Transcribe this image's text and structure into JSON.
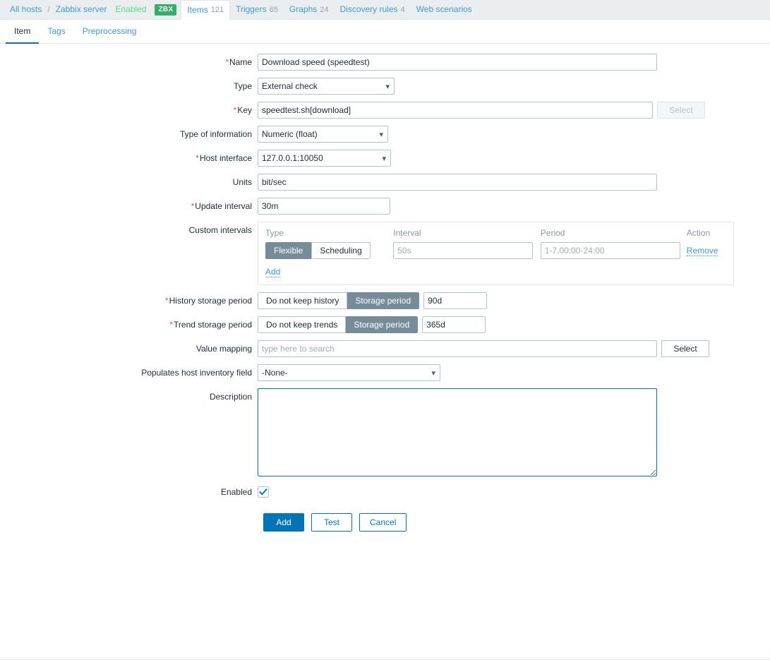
{
  "breadcrumb": {
    "all_hosts": "All hosts",
    "separator": "/",
    "host": "Zabbix server",
    "status": "Enabled",
    "agent_badge": "ZBX",
    "items": [
      {
        "label": "Items",
        "count": "121",
        "selected": true
      },
      {
        "label": "Triggers",
        "count": "65",
        "selected": false
      },
      {
        "label": "Graphs",
        "count": "24",
        "selected": false
      },
      {
        "label": "Discovery rules",
        "count": "4",
        "selected": false
      },
      {
        "label": "Web scenarios",
        "count": "",
        "selected": false
      }
    ]
  },
  "tabs": [
    {
      "label": "Item",
      "active": true
    },
    {
      "label": "Tags",
      "active": false
    },
    {
      "label": "Preprocessing",
      "active": false
    }
  ],
  "form": {
    "name": {
      "label": "Name",
      "required": true,
      "value": "Download speed (speedtest)"
    },
    "type": {
      "label": "Type",
      "required": false,
      "value": "External check"
    },
    "key": {
      "label": "Key",
      "required": true,
      "value": "speedtest.sh[download]",
      "select_button": "Select",
      "select_disabled": true
    },
    "type_of_information": {
      "label": "Type of information",
      "required": false,
      "value": "Numeric (float)"
    },
    "host_interface": {
      "label": "Host interface",
      "required": true,
      "value": "127.0.0.1:10050"
    },
    "units": {
      "label": "Units",
      "required": false,
      "value": "bit/sec"
    },
    "update_interval": {
      "label": "Update interval",
      "required": true,
      "value": "30m"
    },
    "custom_intervals": {
      "label": "Custom intervals",
      "headers": {
        "type": "Type",
        "interval": "Interval",
        "period": "Period",
        "action": "Action"
      },
      "rows": [
        {
          "type_flexible": "Flexible",
          "type_scheduling": "Scheduling",
          "type_selected": "Flexible",
          "interval_value": "",
          "interval_placeholder": "50s",
          "period_value": "",
          "period_placeholder": "1-7,00:00-24:00",
          "remove_label": "Remove"
        }
      ],
      "add_label": "Add"
    },
    "history_storage_period": {
      "label": "History storage period",
      "required": true,
      "option_off": "Do not keep history",
      "option_on": "Storage period",
      "selected": "Storage period",
      "value": "90d"
    },
    "trend_storage_period": {
      "label": "Trend storage period",
      "required": true,
      "option_off": "Do not keep trends",
      "option_on": "Storage period",
      "selected": "Storage period",
      "value": "365d"
    },
    "value_mapping": {
      "label": "Value mapping",
      "required": false,
      "value": "",
      "placeholder": "type here to search",
      "select_button": "Select",
      "select_disabled": false
    },
    "populates_host_inventory_field": {
      "label": "Populates host inventory field",
      "required": false,
      "value": "-None-"
    },
    "description": {
      "label": "Description",
      "required": false,
      "value": "",
      "focused": true
    },
    "enabled": {
      "label": "Enabled",
      "checked": true
    }
  },
  "footer": {
    "add": "Add",
    "test": "Test",
    "cancel": "Cancel"
  },
  "colors": {
    "link": "#3f9bd1",
    "primary": "#0275b8",
    "required": "#d45a54",
    "badge_green": "#34af67",
    "status_green": "#59db8f",
    "toggle_on": "#768d99",
    "header_bg": "#ebeef0"
  }
}
